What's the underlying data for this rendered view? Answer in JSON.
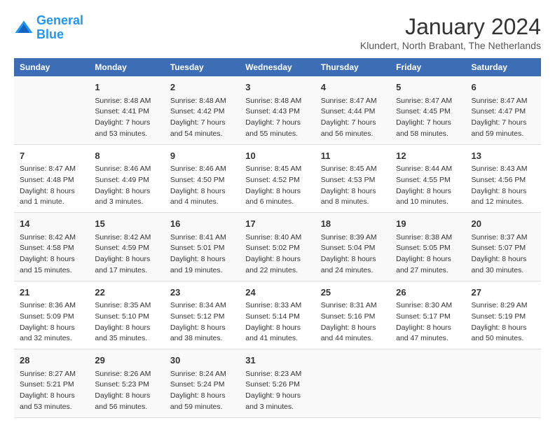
{
  "header": {
    "logo_line1": "General",
    "logo_line2": "Blue",
    "month_title": "January 2024",
    "location": "Klundert, North Brabant, The Netherlands"
  },
  "weekdays": [
    "Sunday",
    "Monday",
    "Tuesday",
    "Wednesday",
    "Thursday",
    "Friday",
    "Saturday"
  ],
  "weeks": [
    [
      {
        "day": "",
        "info": ""
      },
      {
        "day": "1",
        "info": "Sunrise: 8:48 AM\nSunset: 4:41 PM\nDaylight: 7 hours\nand 53 minutes."
      },
      {
        "day": "2",
        "info": "Sunrise: 8:48 AM\nSunset: 4:42 PM\nDaylight: 7 hours\nand 54 minutes."
      },
      {
        "day": "3",
        "info": "Sunrise: 8:48 AM\nSunset: 4:43 PM\nDaylight: 7 hours\nand 55 minutes."
      },
      {
        "day": "4",
        "info": "Sunrise: 8:47 AM\nSunset: 4:44 PM\nDaylight: 7 hours\nand 56 minutes."
      },
      {
        "day": "5",
        "info": "Sunrise: 8:47 AM\nSunset: 4:45 PM\nDaylight: 7 hours\nand 58 minutes."
      },
      {
        "day": "6",
        "info": "Sunrise: 8:47 AM\nSunset: 4:47 PM\nDaylight: 7 hours\nand 59 minutes."
      }
    ],
    [
      {
        "day": "7",
        "info": "Sunrise: 8:47 AM\nSunset: 4:48 PM\nDaylight: 8 hours\nand 1 minute."
      },
      {
        "day": "8",
        "info": "Sunrise: 8:46 AM\nSunset: 4:49 PM\nDaylight: 8 hours\nand 3 minutes."
      },
      {
        "day": "9",
        "info": "Sunrise: 8:46 AM\nSunset: 4:50 PM\nDaylight: 8 hours\nand 4 minutes."
      },
      {
        "day": "10",
        "info": "Sunrise: 8:45 AM\nSunset: 4:52 PM\nDaylight: 8 hours\nand 6 minutes."
      },
      {
        "day": "11",
        "info": "Sunrise: 8:45 AM\nSunset: 4:53 PM\nDaylight: 8 hours\nand 8 minutes."
      },
      {
        "day": "12",
        "info": "Sunrise: 8:44 AM\nSunset: 4:55 PM\nDaylight: 8 hours\nand 10 minutes."
      },
      {
        "day": "13",
        "info": "Sunrise: 8:43 AM\nSunset: 4:56 PM\nDaylight: 8 hours\nand 12 minutes."
      }
    ],
    [
      {
        "day": "14",
        "info": "Sunrise: 8:42 AM\nSunset: 4:58 PM\nDaylight: 8 hours\nand 15 minutes."
      },
      {
        "day": "15",
        "info": "Sunrise: 8:42 AM\nSunset: 4:59 PM\nDaylight: 8 hours\nand 17 minutes."
      },
      {
        "day": "16",
        "info": "Sunrise: 8:41 AM\nSunset: 5:01 PM\nDaylight: 8 hours\nand 19 minutes."
      },
      {
        "day": "17",
        "info": "Sunrise: 8:40 AM\nSunset: 5:02 PM\nDaylight: 8 hours\nand 22 minutes."
      },
      {
        "day": "18",
        "info": "Sunrise: 8:39 AM\nSunset: 5:04 PM\nDaylight: 8 hours\nand 24 minutes."
      },
      {
        "day": "19",
        "info": "Sunrise: 8:38 AM\nSunset: 5:05 PM\nDaylight: 8 hours\nand 27 minutes."
      },
      {
        "day": "20",
        "info": "Sunrise: 8:37 AM\nSunset: 5:07 PM\nDaylight: 8 hours\nand 30 minutes."
      }
    ],
    [
      {
        "day": "21",
        "info": "Sunrise: 8:36 AM\nSunset: 5:09 PM\nDaylight: 8 hours\nand 32 minutes."
      },
      {
        "day": "22",
        "info": "Sunrise: 8:35 AM\nSunset: 5:10 PM\nDaylight: 8 hours\nand 35 minutes."
      },
      {
        "day": "23",
        "info": "Sunrise: 8:34 AM\nSunset: 5:12 PM\nDaylight: 8 hours\nand 38 minutes."
      },
      {
        "day": "24",
        "info": "Sunrise: 8:33 AM\nSunset: 5:14 PM\nDaylight: 8 hours\nand 41 minutes."
      },
      {
        "day": "25",
        "info": "Sunrise: 8:31 AM\nSunset: 5:16 PM\nDaylight: 8 hours\nand 44 minutes."
      },
      {
        "day": "26",
        "info": "Sunrise: 8:30 AM\nSunset: 5:17 PM\nDaylight: 8 hours\nand 47 minutes."
      },
      {
        "day": "27",
        "info": "Sunrise: 8:29 AM\nSunset: 5:19 PM\nDaylight: 8 hours\nand 50 minutes."
      }
    ],
    [
      {
        "day": "28",
        "info": "Sunrise: 8:27 AM\nSunset: 5:21 PM\nDaylight: 8 hours\nand 53 minutes."
      },
      {
        "day": "29",
        "info": "Sunrise: 8:26 AM\nSunset: 5:23 PM\nDaylight: 8 hours\nand 56 minutes."
      },
      {
        "day": "30",
        "info": "Sunrise: 8:24 AM\nSunset: 5:24 PM\nDaylight: 8 hours\nand 59 minutes."
      },
      {
        "day": "31",
        "info": "Sunrise: 8:23 AM\nSunset: 5:26 PM\nDaylight: 9 hours\nand 3 minutes."
      },
      {
        "day": "",
        "info": ""
      },
      {
        "day": "",
        "info": ""
      },
      {
        "day": "",
        "info": ""
      }
    ]
  ]
}
